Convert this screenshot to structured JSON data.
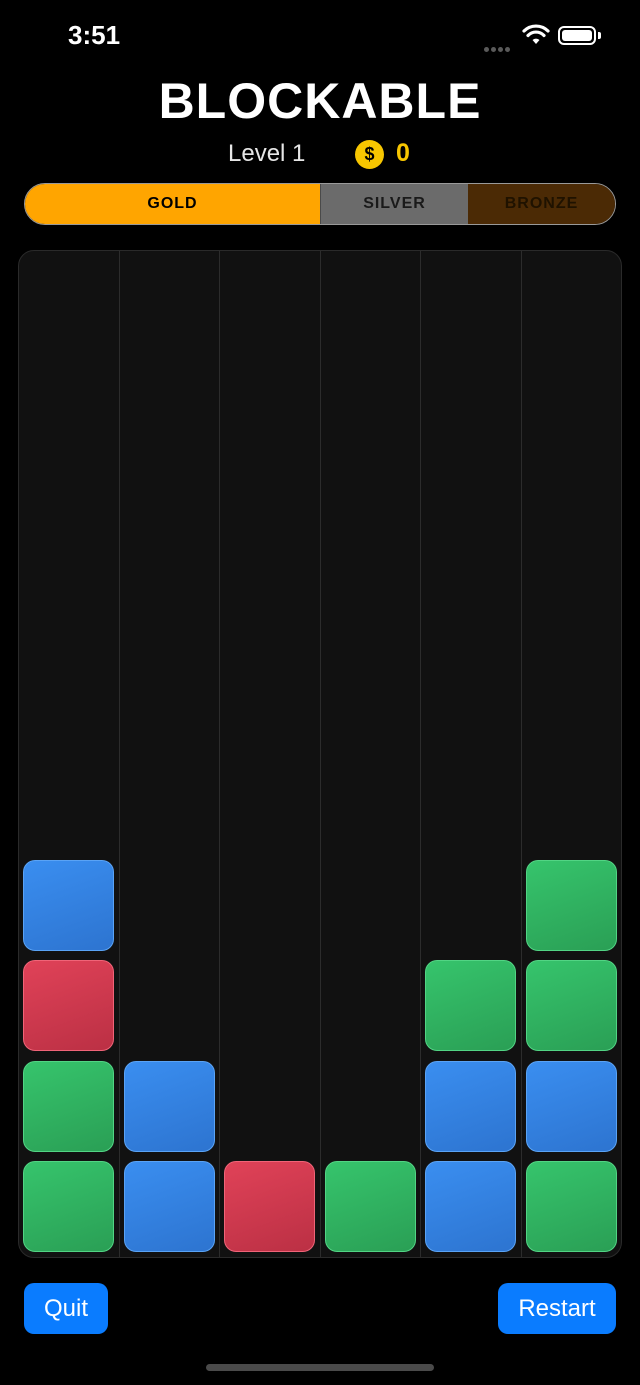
{
  "status_bar": {
    "time": "3:51"
  },
  "header": {
    "title": "BLOCKABLE",
    "level": "Level 1",
    "coin_symbol": "$",
    "coins": "0"
  },
  "medals": {
    "gold": "GOLD",
    "silver": "SILVER",
    "bronze": "BRONZE"
  },
  "colors": {
    "blue": "#3a8ef0",
    "green": "#36c46c",
    "red": "#e04258",
    "gold": "#ffa500",
    "button": "#0a7cff"
  },
  "board": {
    "rows": 10,
    "columns": [
      [
        "green",
        "green",
        "red",
        "blue"
      ],
      [
        "blue",
        "blue"
      ],
      [
        "red"
      ],
      [
        "green"
      ],
      [
        "blue",
        "blue",
        "green"
      ],
      [
        "green",
        "blue",
        "green",
        "green"
      ]
    ]
  },
  "buttons": {
    "quit": "Quit",
    "restart": "Restart"
  }
}
